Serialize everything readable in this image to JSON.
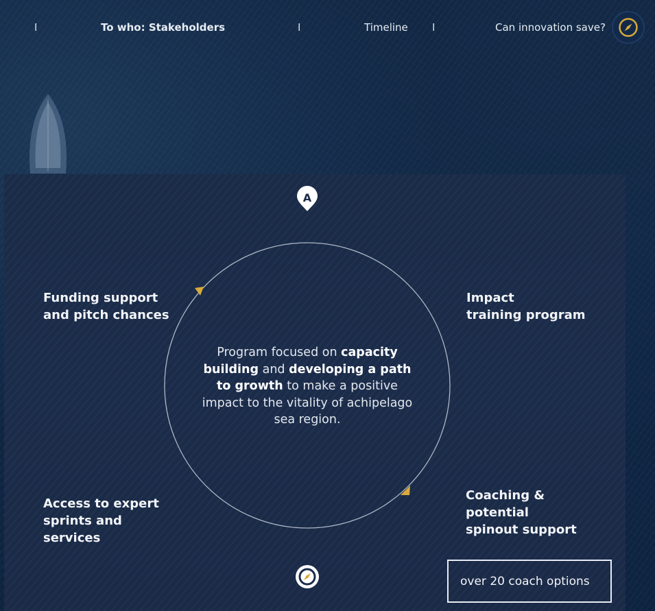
{
  "nav": {
    "separators": [
      "I",
      "I",
      "I"
    ],
    "links": [
      "To who: Stakeholders",
      "Timeline",
      "Can innovation save?"
    ],
    "compass_icon": "compass-icon"
  },
  "program": {
    "center_text": {
      "part1": "Program focused on ",
      "bold1": "capacity building",
      "part2": " and ",
      "bold2": "developing a path to growth",
      "part3": " to make a positive impact to the vitality of achipelago sea region."
    },
    "top_icon_letter": "A",
    "labels": {
      "top_left": "Funding support\nand pitch chances",
      "top_right": "Impact\ntraining program",
      "bottom_left": "Access to expert\nsprints and\nservices",
      "bottom_right": "Coaching &\npotential\nspinout support"
    },
    "coach_box": "over 20 coach options"
  },
  "colors": {
    "accent": "#d9a93a",
    "background": "#0f2745",
    "panel": "#1b2c4a"
  }
}
